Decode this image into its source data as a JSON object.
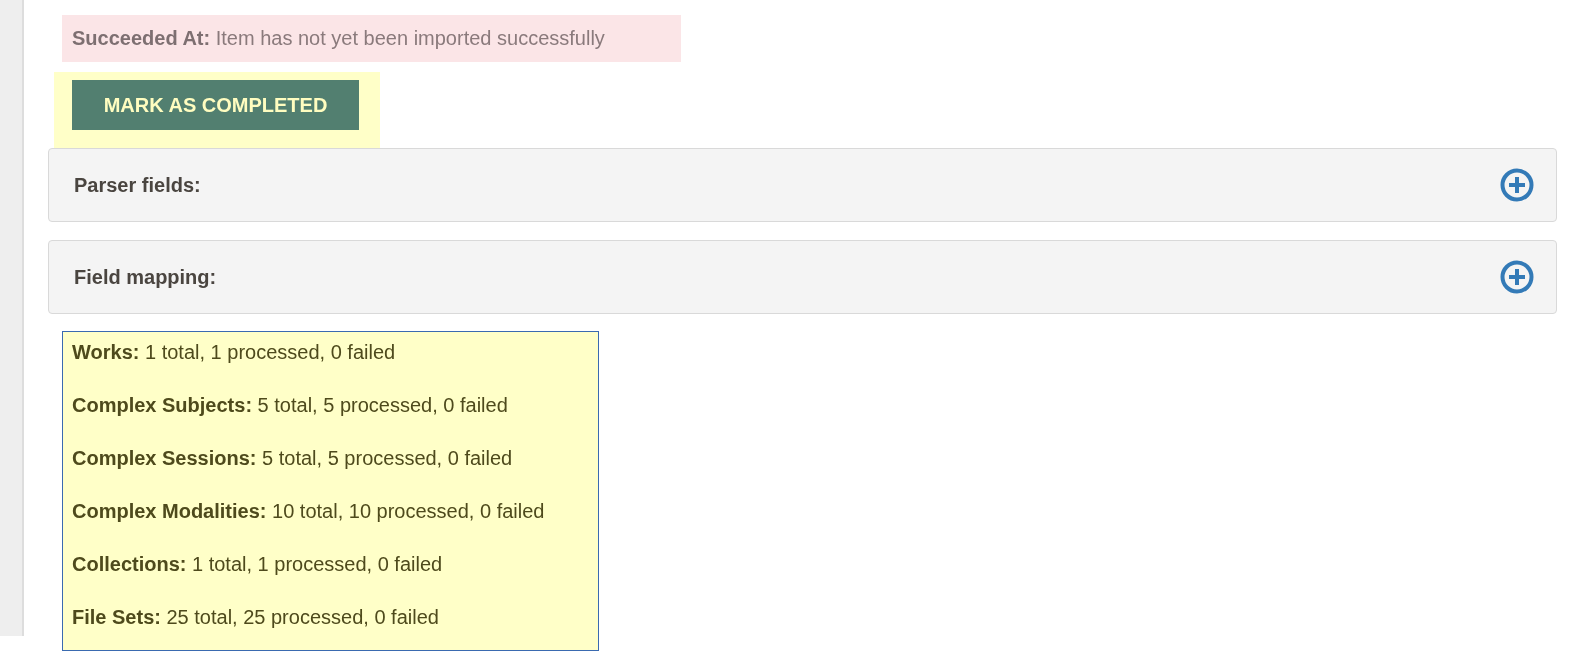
{
  "alert": "**Succeeded At:** Item has not yet been imported successfully",
  "mark_button": {
    "label": "MARK AS COMPLETED"
  },
  "panels": [
    {
      "title": "Parser fields:",
      "expanded": false
    },
    {
      "title": "Field mapping:",
      "expanded": false
    }
  ],
  "stats": [
    "**Works:** 1 total, 1 processed, 0 failed",
    "**Complex Subjects:** 5 total, 5 processed, 0 failed",
    "**Complex Sessions:** 5 total, 5 processed, 0 failed",
    "**Complex Modalities:** 10 total, 10 processed, 0 failed",
    "**Collections:** 1 total, 1 processed, 0 failed",
    "**File Sets:** 25 total, 25 processed, 0 failed"
  ]
}
